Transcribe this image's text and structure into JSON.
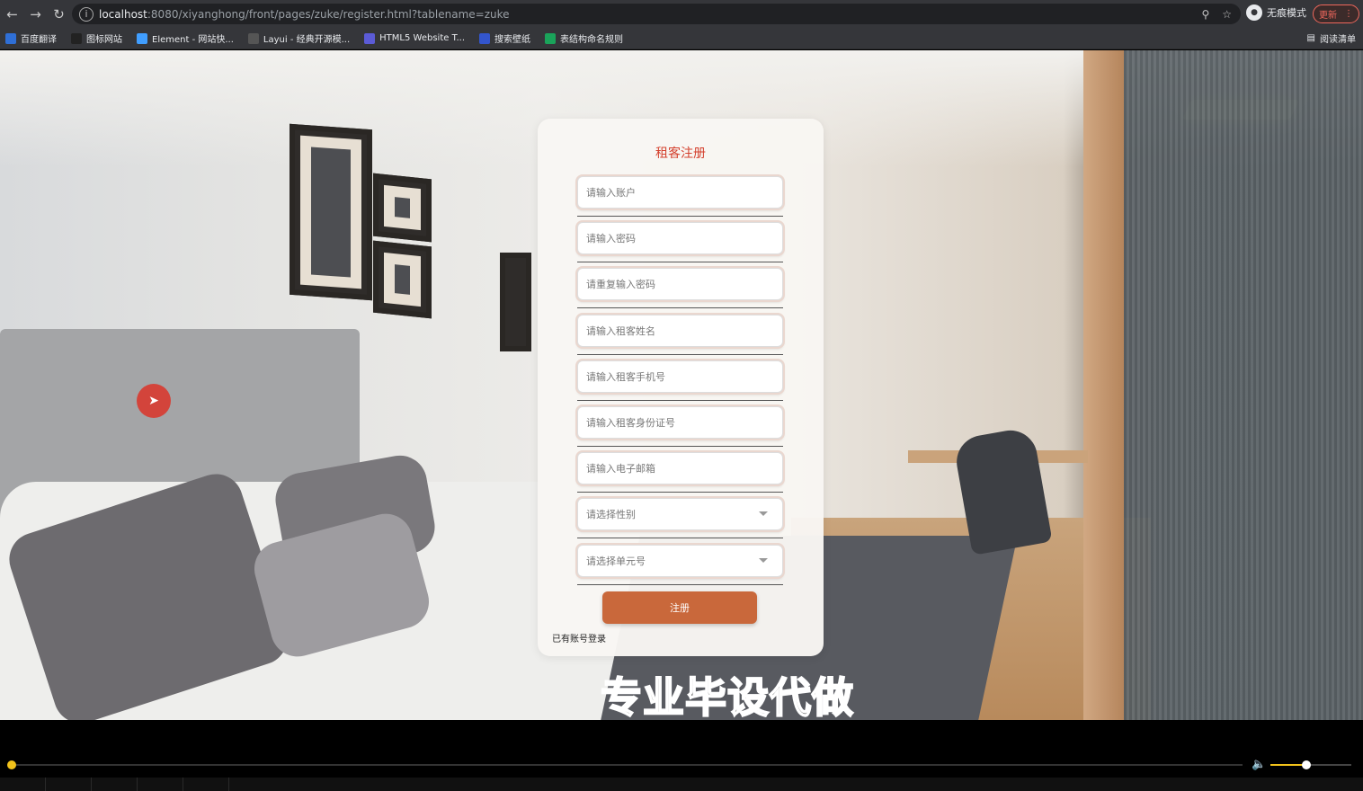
{
  "browser": {
    "url_host": "localhost",
    "url_rest": ":8080/xiyanghong/front/pages/zuke/register.html?tablename=zuke",
    "profile_label": "无痕模式",
    "update_label": "更新",
    "reading_list": "阅读清单",
    "bookmarks": [
      {
        "label": "百度翻译",
        "color": "#2f6fd6"
      },
      {
        "label": "图标网站",
        "color": "#222222"
      },
      {
        "label": "Element - 网站快...",
        "color": "#409eff"
      },
      {
        "label": "Layui - 经典开源模...",
        "color": "#555555"
      },
      {
        "label": "HTML5 Website T...",
        "color": "#5b5bd6"
      },
      {
        "label": "搜索壁纸",
        "color": "#3355cc"
      },
      {
        "label": "表结构命名规则",
        "color": "#1aa35a"
      }
    ]
  },
  "form": {
    "title": "租客注册",
    "fields": [
      {
        "placeholder": "请输入账户",
        "type": "input"
      },
      {
        "placeholder": "请输入密码",
        "type": "input"
      },
      {
        "placeholder": "请重复输入密码",
        "type": "input"
      },
      {
        "placeholder": "请输入租客姓名",
        "type": "input"
      },
      {
        "placeholder": "请输入租客手机号",
        "type": "input"
      },
      {
        "placeholder": "请输入租客身份证号",
        "type": "input"
      },
      {
        "placeholder": "请输入电子邮箱",
        "type": "input"
      },
      {
        "placeholder": "请选择性别",
        "type": "select"
      },
      {
        "placeholder": "请选择单元号",
        "type": "select"
      }
    ],
    "submit_label": "注册",
    "login_link": "已有账号登录",
    "accent_color": "#c9683b",
    "title_color": "#d4412e"
  },
  "overlay": {
    "watermark": "专业毕设代做"
  },
  "player": {
    "progress": 0.0,
    "volume": 0.4
  }
}
